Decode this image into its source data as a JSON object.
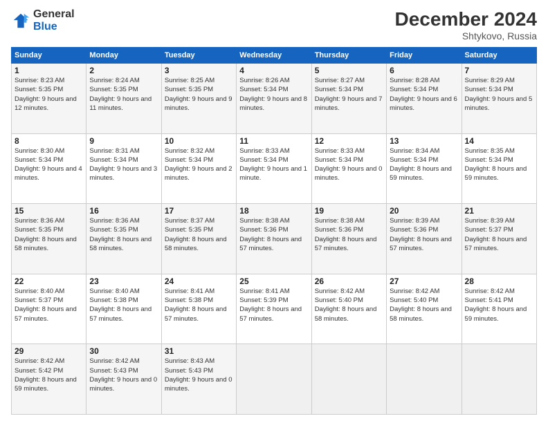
{
  "logo": {
    "line1": "General",
    "line2": "Blue"
  },
  "title": "December 2024",
  "location": "Shtykovo, Russia",
  "days_of_week": [
    "Sunday",
    "Monday",
    "Tuesday",
    "Wednesday",
    "Thursday",
    "Friday",
    "Saturday"
  ],
  "weeks": [
    [
      {
        "day": "1",
        "sunrise": "8:23 AM",
        "sunset": "5:35 PM",
        "daylight": "9 hours and 12 minutes."
      },
      {
        "day": "2",
        "sunrise": "8:24 AM",
        "sunset": "5:35 PM",
        "daylight": "9 hours and 11 minutes."
      },
      {
        "day": "3",
        "sunrise": "8:25 AM",
        "sunset": "5:35 PM",
        "daylight": "9 hours and 9 minutes."
      },
      {
        "day": "4",
        "sunrise": "8:26 AM",
        "sunset": "5:34 PM",
        "daylight": "9 hours and 8 minutes."
      },
      {
        "day": "5",
        "sunrise": "8:27 AM",
        "sunset": "5:34 PM",
        "daylight": "9 hours and 7 minutes."
      },
      {
        "day": "6",
        "sunrise": "8:28 AM",
        "sunset": "5:34 PM",
        "daylight": "9 hours and 6 minutes."
      },
      {
        "day": "7",
        "sunrise": "8:29 AM",
        "sunset": "5:34 PM",
        "daylight": "9 hours and 5 minutes."
      }
    ],
    [
      {
        "day": "8",
        "sunrise": "8:30 AM",
        "sunset": "5:34 PM",
        "daylight": "9 hours and 4 minutes."
      },
      {
        "day": "9",
        "sunrise": "8:31 AM",
        "sunset": "5:34 PM",
        "daylight": "9 hours and 3 minutes."
      },
      {
        "day": "10",
        "sunrise": "8:32 AM",
        "sunset": "5:34 PM",
        "daylight": "9 hours and 2 minutes."
      },
      {
        "day": "11",
        "sunrise": "8:33 AM",
        "sunset": "5:34 PM",
        "daylight": "9 hours and 1 minute."
      },
      {
        "day": "12",
        "sunrise": "8:33 AM",
        "sunset": "5:34 PM",
        "daylight": "9 hours and 0 minutes."
      },
      {
        "day": "13",
        "sunrise": "8:34 AM",
        "sunset": "5:34 PM",
        "daylight": "8 hours and 59 minutes."
      },
      {
        "day": "14",
        "sunrise": "8:35 AM",
        "sunset": "5:34 PM",
        "daylight": "8 hours and 59 minutes."
      }
    ],
    [
      {
        "day": "15",
        "sunrise": "8:36 AM",
        "sunset": "5:35 PM",
        "daylight": "8 hours and 58 minutes."
      },
      {
        "day": "16",
        "sunrise": "8:36 AM",
        "sunset": "5:35 PM",
        "daylight": "8 hours and 58 minutes."
      },
      {
        "day": "17",
        "sunrise": "8:37 AM",
        "sunset": "5:35 PM",
        "daylight": "8 hours and 58 minutes."
      },
      {
        "day": "18",
        "sunrise": "8:38 AM",
        "sunset": "5:36 PM",
        "daylight": "8 hours and 57 minutes."
      },
      {
        "day": "19",
        "sunrise": "8:38 AM",
        "sunset": "5:36 PM",
        "daylight": "8 hours and 57 minutes."
      },
      {
        "day": "20",
        "sunrise": "8:39 AM",
        "sunset": "5:36 PM",
        "daylight": "8 hours and 57 minutes."
      },
      {
        "day": "21",
        "sunrise": "8:39 AM",
        "sunset": "5:37 PM",
        "daylight": "8 hours and 57 minutes."
      }
    ],
    [
      {
        "day": "22",
        "sunrise": "8:40 AM",
        "sunset": "5:37 PM",
        "daylight": "8 hours and 57 minutes."
      },
      {
        "day": "23",
        "sunrise": "8:40 AM",
        "sunset": "5:38 PM",
        "daylight": "8 hours and 57 minutes."
      },
      {
        "day": "24",
        "sunrise": "8:41 AM",
        "sunset": "5:38 PM",
        "daylight": "8 hours and 57 minutes."
      },
      {
        "day": "25",
        "sunrise": "8:41 AM",
        "sunset": "5:39 PM",
        "daylight": "8 hours and 57 minutes."
      },
      {
        "day": "26",
        "sunrise": "8:42 AM",
        "sunset": "5:40 PM",
        "daylight": "8 hours and 58 minutes."
      },
      {
        "day": "27",
        "sunrise": "8:42 AM",
        "sunset": "5:40 PM",
        "daylight": "8 hours and 58 minutes."
      },
      {
        "day": "28",
        "sunrise": "8:42 AM",
        "sunset": "5:41 PM",
        "daylight": "8 hours and 59 minutes."
      }
    ],
    [
      {
        "day": "29",
        "sunrise": "8:42 AM",
        "sunset": "5:42 PM",
        "daylight": "8 hours and 59 minutes."
      },
      {
        "day": "30",
        "sunrise": "8:42 AM",
        "sunset": "5:43 PM",
        "daylight": "9 hours and 0 minutes."
      },
      {
        "day": "31",
        "sunrise": "8:43 AM",
        "sunset": "5:43 PM",
        "daylight": "9 hours and 0 minutes."
      },
      null,
      null,
      null,
      null
    ]
  ]
}
